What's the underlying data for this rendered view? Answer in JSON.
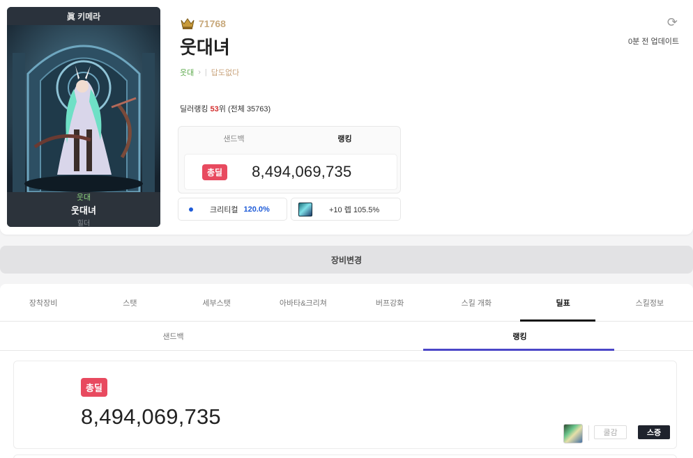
{
  "character": {
    "server": "眞 키메라",
    "guild": "웃대",
    "name": "웃대녀",
    "job": "힐더",
    "fame": "71768",
    "title_name": "웃대녀",
    "adventure": "답도없다",
    "update_text": "0분 전 업데이트"
  },
  "ranking": {
    "prefix": "딜러랭킹",
    "rank": "53",
    "rank_suffix": "위",
    "total": "(전체 35763)"
  },
  "damage_panel": {
    "tabs": [
      "샌드백",
      "랭킹"
    ],
    "active_tab": "랭킹",
    "badge": "총딜",
    "total_damage": "8,494,069,735"
  },
  "stats": {
    "crit_label": "크리티컬",
    "crit_value": "120.0%",
    "weapon_label": "+10 렙 105.5%"
  },
  "equip_bar": {
    "label": "장비변경"
  },
  "nav_tabs": [
    "장착장비",
    "스탯",
    "세부스탯",
    "아바타&크리쳐",
    "버프강화",
    "스킬 개화",
    "딜표",
    "스킬정보"
  ],
  "active_nav": "딜표",
  "sub_tabs": [
    "샌드백",
    "랭킹"
  ],
  "active_sub": "랭킹",
  "result": {
    "badge": "총딜",
    "total_damage": "8,494,069,735",
    "buttons": {
      "cooldown": "쿨감",
      "stack": "스증"
    }
  },
  "colors": {
    "badge": "#e84a5f",
    "crit": "#1e5bd8",
    "active_underline": "#4b46c8",
    "fame": "#c8a97c",
    "guild": "#5daa4c"
  }
}
